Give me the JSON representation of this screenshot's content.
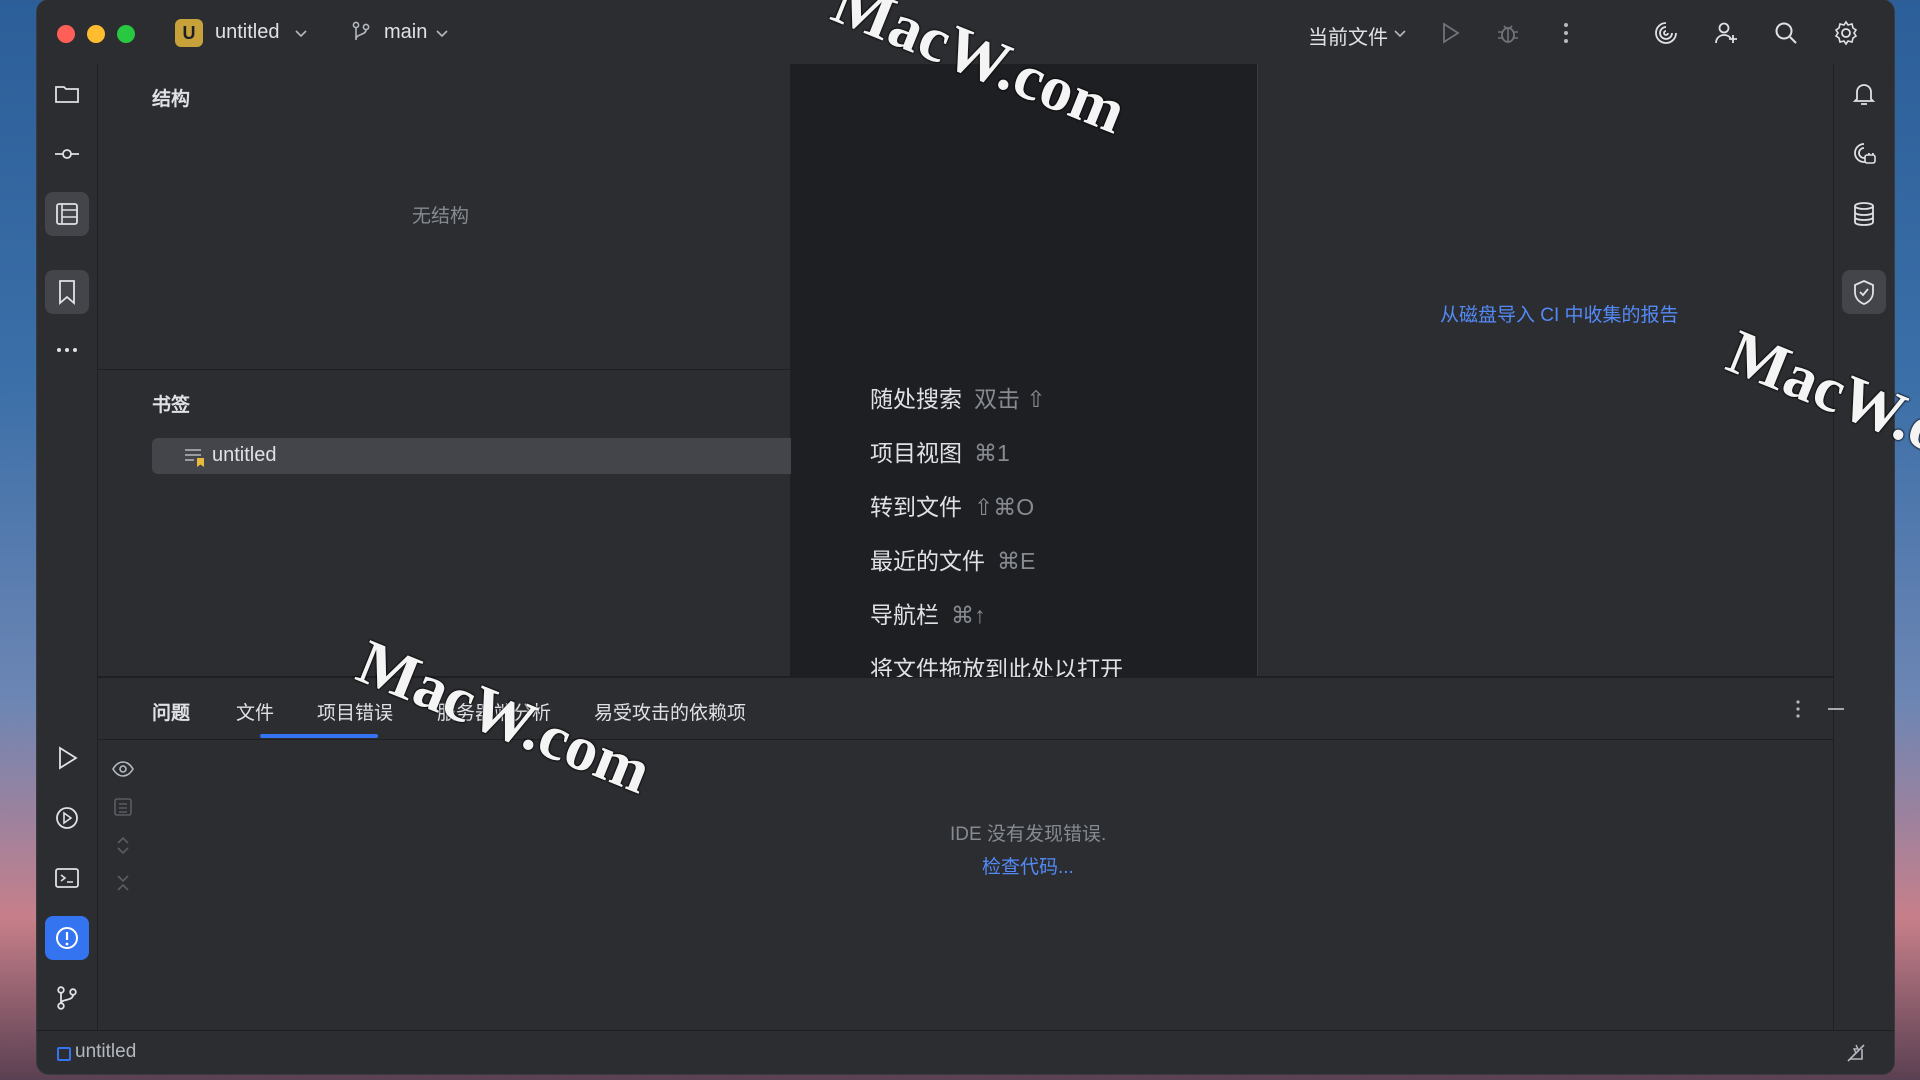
{
  "window": {
    "project_badge": "U",
    "project_name": "untitled",
    "branch": "main",
    "run_config": "当前文件"
  },
  "structure": {
    "title": "结构",
    "empty": "无结构"
  },
  "bookmarks": {
    "title": "书签",
    "items": [
      {
        "label": "untitled"
      }
    ]
  },
  "editor_hints": [
    {
      "label": "随处搜索",
      "shortcut": "双击 ⇧"
    },
    {
      "label": "项目视图",
      "shortcut": "⌘1"
    },
    {
      "label": "转到文件",
      "shortcut": "⇧⌘O"
    },
    {
      "label": "最近的文件",
      "shortcut": "⌘E"
    },
    {
      "label": "导航栏",
      "shortcut": "⌘↑"
    },
    {
      "label": "将文件拖放到此处以打开",
      "shortcut": ""
    }
  ],
  "ci_panel": {
    "link": "从磁盘导入 CI 中收集的报告"
  },
  "problems": {
    "tabs": [
      {
        "label": "问题"
      },
      {
        "label": "文件"
      },
      {
        "label": "项目错误"
      },
      {
        "label": "服务器端分析"
      },
      {
        "label": "易受攻击的依赖项"
      }
    ],
    "message": "IDE 没有发现错误.",
    "action": "检查代码..."
  },
  "status": {
    "project": "untitled"
  },
  "watermark": "MacW.com",
  "colors": {
    "accent": "#3574f0",
    "link": "#548af7",
    "background": "#1e1f22",
    "panel": "#2b2d30"
  }
}
